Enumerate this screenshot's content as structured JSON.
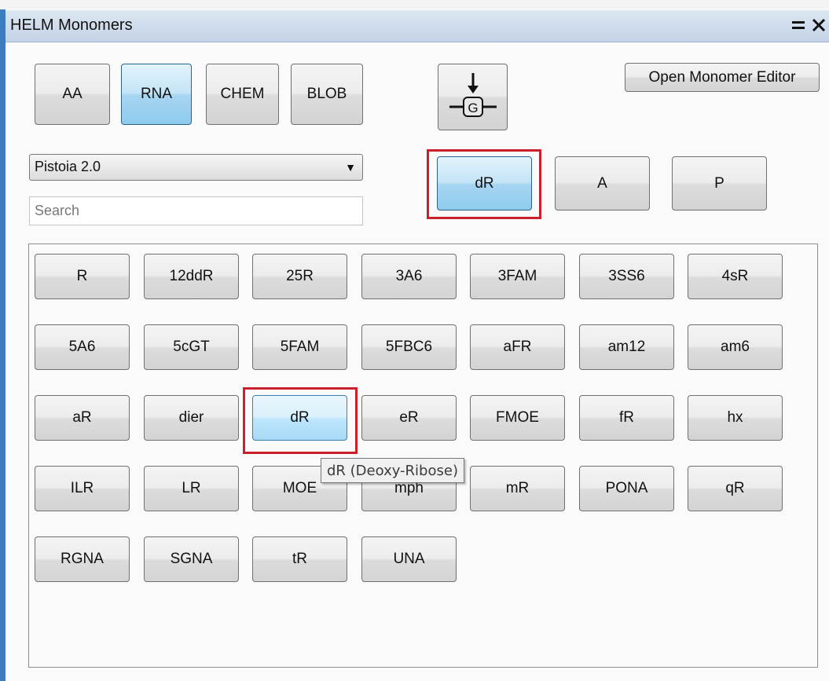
{
  "window": {
    "title": "HELM Monomers",
    "menu_icon": "menu-icon",
    "close_icon": "close-icon"
  },
  "polymer_types": [
    {
      "label": "AA",
      "selected": false
    },
    {
      "label": "RNA",
      "selected": true
    },
    {
      "label": "CHEM",
      "selected": false
    },
    {
      "label": "BLOB",
      "selected": false
    }
  ],
  "toolbar": {
    "glyph_button_icon": "monomer-g-arrow-icon",
    "glyph_letter": "G",
    "open_editor_label": "Open Monomer Editor"
  },
  "library_select": {
    "value": "Pistoia 2.0"
  },
  "search": {
    "placeholder": "Search",
    "value": ""
  },
  "nucleotide_parts": [
    {
      "label": "dR",
      "selected": true,
      "highlighted": true
    },
    {
      "label": "A",
      "selected": false,
      "highlighted": false
    },
    {
      "label": "P",
      "selected": false,
      "highlighted": false
    }
  ],
  "monomers": [
    "R",
    "12ddR",
    "25R",
    "3A6",
    "3FAM",
    "3SS6",
    "4sR",
    "5A6",
    "5cGT",
    "5FAM",
    "5FBC6",
    "aFR",
    "am12",
    "am6",
    "aR",
    "dier",
    "dR",
    "eR",
    "FMOE",
    "fR",
    "hx",
    "ILR",
    "LR",
    "MOE",
    "mph",
    "mR",
    "PONA",
    "qR",
    "RGNA",
    "SGNA",
    "tR",
    "UNA"
  ],
  "hovered_monomer": "dR",
  "tooltip": {
    "text": "dR (Deoxy-Ribose)"
  },
  "colors": {
    "highlight": "#cc1f2d",
    "selected_button": "#a7d5f2",
    "title_bar": "#c3d2e6"
  }
}
